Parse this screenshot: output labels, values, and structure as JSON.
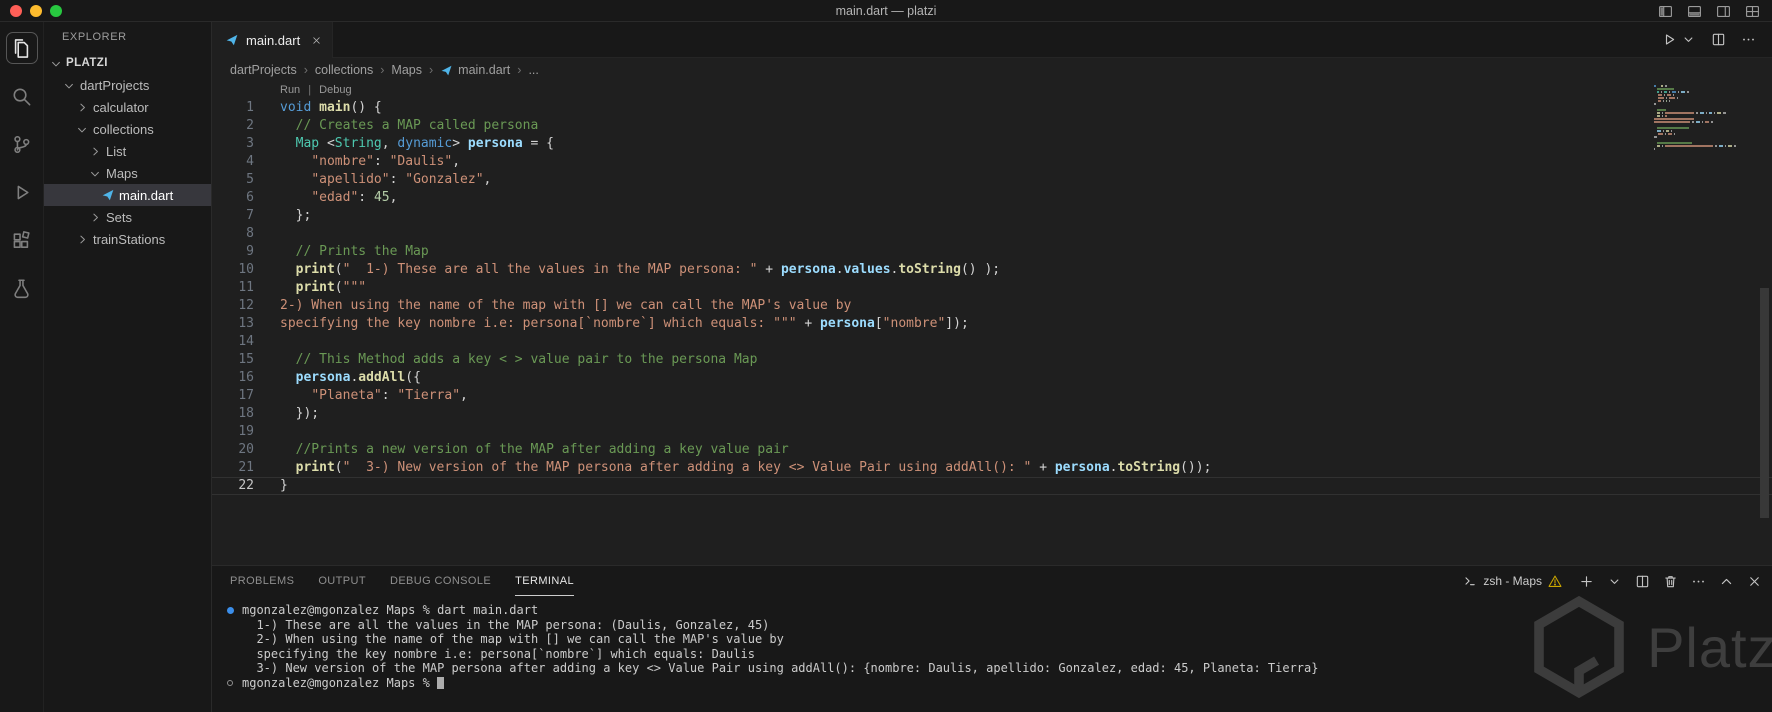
{
  "window": {
    "title": "main.dart — platzi",
    "traffic_lights": [
      {
        "name": "close",
        "color": "#ff5f57"
      },
      {
        "name": "minimize",
        "color": "#febc2e"
      },
      {
        "name": "zoom",
        "color": "#28c840"
      }
    ],
    "layout_icons": [
      {
        "name": "toggle-primary-sidebar",
        "icon": "layout-sidebar-left"
      },
      {
        "name": "toggle-panel",
        "icon": "layout-panel"
      },
      {
        "name": "toggle-secondary-sidebar",
        "icon": "layout-sidebar-right"
      },
      {
        "name": "customize-layout",
        "icon": "layout-customize"
      }
    ]
  },
  "activity_bar": {
    "items": [
      {
        "name": "explorer",
        "active": true
      },
      {
        "name": "search",
        "active": false
      },
      {
        "name": "source-control",
        "active": false
      },
      {
        "name": "run-debug",
        "active": false
      },
      {
        "name": "extensions",
        "active": false
      },
      {
        "name": "testing",
        "active": false
      }
    ]
  },
  "explorer": {
    "title": "EXPLORER",
    "section": "PLATZI",
    "items": [
      {
        "label": "dartProjects",
        "indent": 0,
        "chevron": "down",
        "type": "folder"
      },
      {
        "label": "calculator",
        "indent": 1,
        "chevron": "right",
        "type": "folder"
      },
      {
        "label": "collections",
        "indent": 1,
        "chevron": "down",
        "type": "folder"
      },
      {
        "label": "List",
        "indent": 2,
        "chevron": "right",
        "type": "folder"
      },
      {
        "label": "Maps",
        "indent": 2,
        "chevron": "down",
        "type": "folder"
      },
      {
        "label": "main.dart",
        "indent": 3,
        "type": "dart-file",
        "selected": true
      },
      {
        "label": "Sets",
        "indent": 2,
        "chevron": "right",
        "type": "folder"
      },
      {
        "label": "trainStations",
        "indent": 1,
        "chevron": "right",
        "type": "folder"
      }
    ]
  },
  "editor": {
    "tab": {
      "label": "main.dart"
    },
    "actions": [
      {
        "name": "run-or-debug",
        "icon": "play"
      },
      {
        "name": "run-dropdown",
        "icon": "chevron-down-small"
      },
      {
        "name": "split-editor",
        "icon": "split-editor"
      },
      {
        "name": "editor-more-actions",
        "icon": "ellipsis"
      }
    ],
    "breadcrumbs": [
      {
        "label": "dartProjects"
      },
      {
        "label": "collections"
      },
      {
        "label": "Maps"
      },
      {
        "label": "main.dart",
        "icon": "dart"
      },
      {
        "label": "..."
      }
    ],
    "codelens": {
      "run": "Run",
      "separator": "|",
      "debug": "Debug"
    },
    "current_line": 22,
    "code_lines": [
      [
        [
          "k",
          "void"
        ],
        [
          "p",
          " "
        ],
        [
          "f",
          "main"
        ],
        [
          "p",
          "() {"
        ]
      ],
      [
        [
          "p",
          "  "
        ],
        [
          "c",
          "// Creates a MAP called persona"
        ]
      ],
      [
        [
          "p",
          "  "
        ],
        [
          "t",
          "Map"
        ],
        [
          "p",
          " <"
        ],
        [
          "t",
          "String"
        ],
        [
          "p",
          ", "
        ],
        [
          "k",
          "dynamic"
        ],
        [
          "p",
          "> "
        ],
        [
          "v",
          "persona"
        ],
        [
          "p",
          " = {"
        ]
      ],
      [
        [
          "p",
          "    "
        ],
        [
          "s",
          "\"nombre\""
        ],
        [
          "p",
          ": "
        ],
        [
          "s",
          "\"Daulis\""
        ],
        [
          "p",
          ","
        ]
      ],
      [
        [
          "p",
          "    "
        ],
        [
          "s",
          "\"apellido\""
        ],
        [
          "p",
          ": "
        ],
        [
          "s",
          "\"Gonzalez\""
        ],
        [
          "p",
          ","
        ]
      ],
      [
        [
          "p",
          "    "
        ],
        [
          "s",
          "\"edad\""
        ],
        [
          "p",
          ": "
        ],
        [
          "n",
          "45"
        ],
        [
          "p",
          ","
        ]
      ],
      [
        [
          "p",
          "  };"
        ]
      ],
      [],
      [
        [
          "p",
          "  "
        ],
        [
          "c",
          "// Prints the Map"
        ]
      ],
      [
        [
          "p",
          "  "
        ],
        [
          "f",
          "print"
        ],
        [
          "p",
          "("
        ],
        [
          "s",
          "\"  1-) These are all the values in the MAP persona: \""
        ],
        [
          "p",
          " + "
        ],
        [
          "v",
          "persona"
        ],
        [
          "p",
          "."
        ],
        [
          "v",
          "values"
        ],
        [
          "p",
          "."
        ],
        [
          "f",
          "toString"
        ],
        [
          "p",
          "() );"
        ]
      ],
      [
        [
          "p",
          "  "
        ],
        [
          "f",
          "print"
        ],
        [
          "p",
          "("
        ],
        [
          "s",
          "\"\"\""
        ]
      ],
      [
        [
          "s",
          "2-) When using the name of the map with [] we can call the MAP's value by"
        ]
      ],
      [
        [
          "s",
          "specifying the key nombre i.e: persona[`nombre`] which equals: \"\"\""
        ],
        [
          "p",
          " + "
        ],
        [
          "v",
          "persona"
        ],
        [
          "p",
          "["
        ],
        [
          "s",
          "\"nombre\""
        ],
        [
          "p",
          "]);"
        ]
      ],
      [],
      [
        [
          "p",
          "  "
        ],
        [
          "c",
          "// This Method adds a key < > value pair to the persona Map"
        ]
      ],
      [
        [
          "p",
          "  "
        ],
        [
          "v",
          "persona"
        ],
        [
          "p",
          "."
        ],
        [
          "f",
          "addAll"
        ],
        [
          "p",
          "({"
        ]
      ],
      [
        [
          "p",
          "    "
        ],
        [
          "s",
          "\"Planeta\""
        ],
        [
          "p",
          ": "
        ],
        [
          "s",
          "\"Tierra\""
        ],
        [
          "p",
          ","
        ]
      ],
      [
        [
          "p",
          "  });"
        ]
      ],
      [],
      [
        [
          "p",
          "  "
        ],
        [
          "c",
          "//Prints a new version of the MAP after adding a key value pair"
        ]
      ],
      [
        [
          "p",
          "  "
        ],
        [
          "f",
          "print"
        ],
        [
          "p",
          "("
        ],
        [
          "s",
          "\"  3-) New version of the MAP persona after adding a key <> Value Pair using addAll(): \""
        ],
        [
          "p",
          " + "
        ],
        [
          "v",
          "persona"
        ],
        [
          "p",
          "."
        ],
        [
          "f",
          "toString"
        ],
        [
          "p",
          "());"
        ]
      ],
      [
        [
          "p",
          "}"
        ]
      ]
    ]
  },
  "panel": {
    "tabs": [
      {
        "label": "PROBLEMS",
        "active": false
      },
      {
        "label": "OUTPUT",
        "active": false
      },
      {
        "label": "DEBUG CONSOLE",
        "active": false
      },
      {
        "label": "TERMINAL",
        "active": true
      }
    ],
    "terminal_select": "zsh - Maps",
    "has_warning": true,
    "actions": [
      {
        "name": "new-terminal",
        "icon": "plus"
      },
      {
        "name": "launch-profile-dropdown",
        "icon": "chevron-down-small"
      },
      {
        "name": "split-terminal",
        "icon": "split-editor"
      },
      {
        "name": "kill-terminal",
        "icon": "trash"
      },
      {
        "name": "terminal-more-actions",
        "icon": "ellipsis"
      },
      {
        "name": "maximize-panel",
        "icon": "chevron-up"
      },
      {
        "name": "close-panel",
        "icon": "close"
      }
    ],
    "terminal_lines": [
      {
        "decoration": "filled",
        "text": "mgonzalez@mgonzalez Maps % dart main.dart"
      },
      {
        "text": "  1-) These are all the values in the MAP persona: (Daulis, Gonzalez, 45)"
      },
      {
        "text": "  2-) When using the name of the map with [] we can call the MAP's value by"
      },
      {
        "text": "  specifying the key nombre i.e: persona[`nombre`] which equals: Daulis"
      },
      {
        "text": "  3-) New version of the MAP persona after adding a key <> Value Pair using addAll(): {nombre: Daulis, apellido: Gonzalez, edad: 45, Planeta: Tierra}"
      },
      {
        "decoration": "outline",
        "text": "mgonzalez@mgonzalez Maps % ",
        "cursor": true
      }
    ]
  },
  "watermark": {
    "text": "Platzi"
  },
  "colors": {
    "accent_blue": "#3b8eea",
    "dart_icon": "#4fb4e8",
    "warning": "#cca700",
    "selection_bg": "#37373d"
  }
}
